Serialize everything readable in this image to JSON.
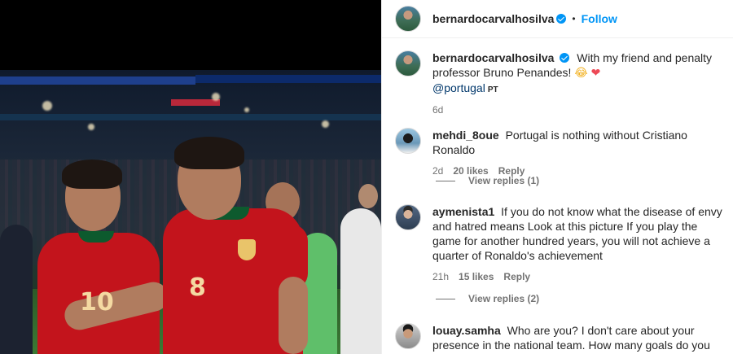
{
  "header": {
    "username": "bernardocarvalhosilva",
    "separator": "•",
    "follow_label": "Follow"
  },
  "caption": {
    "username": "bernardocarvalhosilva",
    "text": "With my friend and penalty professor Bruno Penandes!",
    "emoji_laugh": "😂",
    "emoji_heart": "❤",
    "mention": "@portugal",
    "mention_tag": "PT",
    "time": "6d"
  },
  "comments": [
    {
      "username": "mehdi_8oue",
      "text": "Portugal is nothing without Cristiano Ronaldo",
      "time": "2d",
      "likes": "20 likes",
      "reply_label": "Reply",
      "view_replies": "View replies (1)"
    },
    {
      "username": "aymenista1",
      "text": "If you do not know what the disease of envy and hatred means Look at this picture If you play the game for another hundred years, you will not achieve a quarter of Ronaldo's achievement",
      "time": "21h",
      "likes": "15 likes",
      "reply_label": "Reply",
      "view_replies": "View replies (2)"
    },
    {
      "username": "louay.samha",
      "text": "Who are you? I don't care about your presence in the national team. How many goals do you have? How old are"
    }
  ],
  "photo": {
    "player_left_number": "10",
    "player_right_number": "8"
  },
  "colors": {
    "accent": "#0095f6",
    "jersey_red": "#c3141c",
    "jersey_green": "#0d5a2e"
  }
}
